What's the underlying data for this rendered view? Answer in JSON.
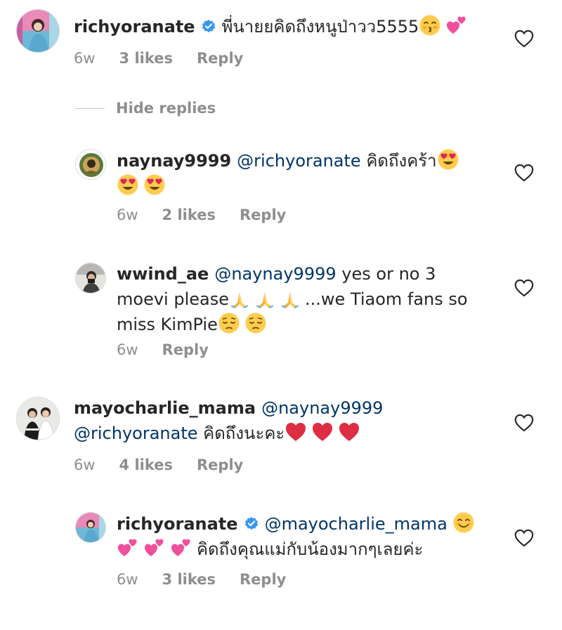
{
  "comments": [
    {
      "username": "richyoranate",
      "verified": true,
      "text": "พี่นายยคิดถึงหนูป่าวว5555",
      "time": "6w",
      "likes": "3 likes",
      "reply": "Reply"
    },
    {
      "username": "naynay9999",
      "mention": "@richyoranate",
      "text": "คิดถึงคร้า",
      "time": "6w",
      "likes": "2 likes",
      "reply": "Reply"
    },
    {
      "username": "wwind_ae",
      "mention": "@naynay9999",
      "text_line1": "yes or no 3",
      "text_line2a": "moevi please",
      "text_line2b": "...we Tiaom fans so",
      "text_line3": "miss KimPie",
      "time": "6w",
      "reply": "Reply"
    },
    {
      "username": "mayocharlie_mama",
      "mention": "@naynay9999",
      "mention2": "@richyoranate",
      "text": "คิดถึงนะคะ",
      "time": "6w",
      "likes": "4 likes",
      "reply": "Reply"
    },
    {
      "username": "richyoranate",
      "verified": true,
      "mention": "@mayocharlie_mama",
      "text": "คิดถึงคุณแม่กับน้องมากๆเลยค่ะ",
      "time": "6w",
      "likes": "3 likes",
      "reply": "Reply"
    }
  ],
  "hide_replies": "Hide replies",
  "colors": {
    "text": "#262626",
    "meta": "#8e8e8e",
    "mention": "#003569",
    "verified": "#3897f0"
  },
  "icons": [
    "verified-badge-icon",
    "heart-outline-icon",
    "kissing-face-emoji",
    "two-hearts-emoji",
    "heart-eyes-emoji",
    "folded-hands-emoji",
    "pensive-face-emoji",
    "red-heart-emoji",
    "smiling-face-emoji"
  ]
}
